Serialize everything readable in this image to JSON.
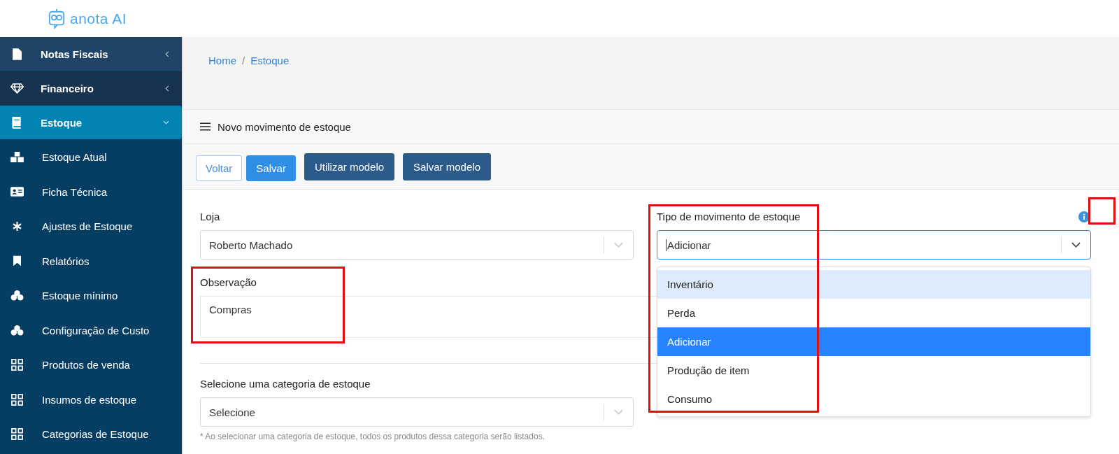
{
  "logo": {
    "text": "anota AI"
  },
  "sidebar": {
    "items": [
      {
        "label": "Notas Fiscais",
        "kind": "file",
        "hovered": true,
        "selected": false,
        "expanded": false
      },
      {
        "label": "Financeiro",
        "kind": "diamond",
        "hovered": false,
        "selected": false,
        "expanded": false
      },
      {
        "label": "Estoque",
        "kind": "book",
        "hovered": false,
        "selected": true,
        "expanded": true,
        "children": [
          {
            "label": "Estoque Atual",
            "kind": "boxes"
          },
          {
            "label": "Ficha Técnica",
            "kind": "card"
          },
          {
            "label": "Ajustes de Estoque",
            "kind": "asterisk"
          },
          {
            "label": "Relatórios",
            "kind": "bookmark"
          },
          {
            "label": "Estoque mínimo",
            "kind": "cubes"
          },
          {
            "label": "Configuração de Custo",
            "kind": "cubes"
          },
          {
            "label": "Produtos de venda",
            "kind": "grid"
          },
          {
            "label": "Insumos de estoque",
            "kind": "grid"
          },
          {
            "label": "Categorias de Estoque",
            "kind": "grid"
          }
        ]
      }
    ]
  },
  "breadcrumb": [
    "Home",
    "Estoque"
  ],
  "breadcrumb_separator": "/",
  "card": {
    "title": "Novo movimento de estoque",
    "buttons": [
      {
        "label": "Voltar",
        "kind": "outline"
      },
      {
        "label": "Salvar",
        "kind": "primary"
      },
      {
        "label": "Utilizar modelo",
        "kind": "dark"
      },
      {
        "label": "Salvar modelo",
        "kind": "dark"
      }
    ],
    "store": {
      "label": "Loja",
      "value": "Roberto Machado"
    },
    "movement_type": {
      "label": "Tipo de movimento de estoque",
      "value": "Adicionar",
      "focused": true,
      "expanded": true,
      "options": [
        {
          "label": "Inventário",
          "hovered": true,
          "selected": false
        },
        {
          "label": "Perda",
          "hovered": false,
          "selected": false
        },
        {
          "label": "Adicionar",
          "hovered": false,
          "selected": true
        },
        {
          "label": "Produção de item",
          "hovered": false,
          "selected": false
        },
        {
          "label": "Consumo",
          "hovered": false,
          "selected": false
        }
      ]
    },
    "observation": {
      "label": "Observação",
      "value": "Compras"
    },
    "category": {
      "label": "Selecione uma categoria de estoque",
      "placeholder": "Selecione",
      "hint": "* Ao selecionar uma categoria de estoque, todos os produtos dessa categoria serão listados."
    }
  },
  "highlight_boxes": {
    "observation": true,
    "movement_type": true,
    "info_icon": true
  }
}
